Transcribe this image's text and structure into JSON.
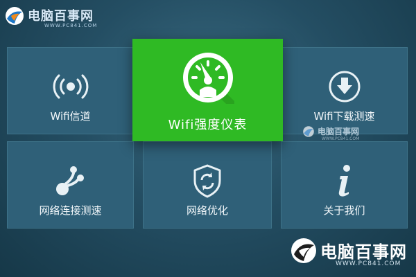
{
  "watermark": {
    "brand": "电脑百事网",
    "url": "WWW.PC841.COM"
  },
  "tiles": {
    "channel": {
      "label": "Wifi信道",
      "icon": "wifi-signal-icon"
    },
    "meter": {
      "label": "Wifi强度仪表",
      "icon": "gauge-icon"
    },
    "download": {
      "label": "Wifi下载测速",
      "icon": "download-icon"
    },
    "speed": {
      "label": "网络连接测速",
      "icon": "connection-icon"
    },
    "optimize": {
      "label": "网络优化",
      "icon": "shield-refresh-icon"
    },
    "about": {
      "label": "关于我们",
      "icon": "info-icon"
    }
  },
  "colors": {
    "background": "#244e63",
    "tile": "#2f6078",
    "highlight": "#2fba24"
  }
}
